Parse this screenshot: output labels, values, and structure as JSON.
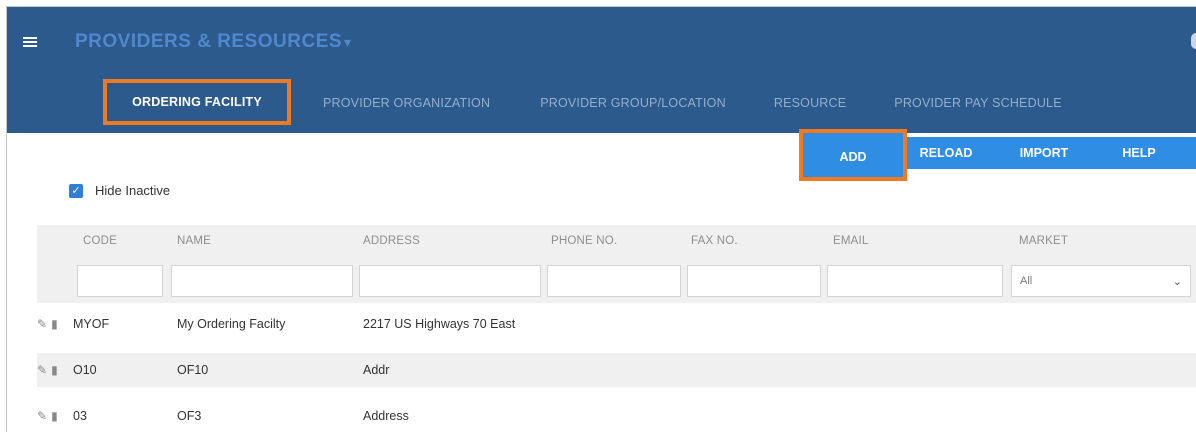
{
  "header": {
    "app_title": "PROVIDERS & RESOURCES",
    "title_caret": "▾",
    "tabs": [
      {
        "label": "ORDERING FACILITY",
        "active": true
      },
      {
        "label": "PROVIDER ORGANIZATION",
        "active": false
      },
      {
        "label": "PROVIDER GROUP/LOCATION",
        "active": false
      },
      {
        "label": "RESOURCE",
        "active": false
      },
      {
        "label": "PROVIDER PAY SCHEDULE",
        "active": false
      }
    ]
  },
  "toolbar": {
    "add_label": "ADD",
    "reload_label": "RELOAD",
    "import_label": "IMPORT",
    "help_label": "HELP"
  },
  "filters": {
    "hide_inactive_label": "Hide Inactive",
    "hide_inactive_checked": true,
    "columns": [
      "CODE",
      "NAME",
      "ADDRESS",
      "PHONE NO.",
      "FAX NO.",
      "EMAIL",
      "MARKET"
    ],
    "market_selected": "All"
  },
  "rows": [
    {
      "code": "MYOF",
      "name": "My Ordering Facilty",
      "address": "2217 US Highways 70 East"
    },
    {
      "code": "O10",
      "name": "OF10",
      "address": "Addr"
    },
    {
      "code": "03",
      "name": "OF3",
      "address": "Address"
    }
  ],
  "colors": {
    "header_bg": "#2d5a8c",
    "toolbar_bg": "#2f8de4",
    "highlight": "#f07a22",
    "checkbox": "#2f7ed8"
  },
  "icons": {
    "menu": "hamburger-icon",
    "edit": "pencil-icon",
    "delete": "trash-icon",
    "check": "checkmark-icon",
    "dropdown": "chevron-down-icon"
  }
}
